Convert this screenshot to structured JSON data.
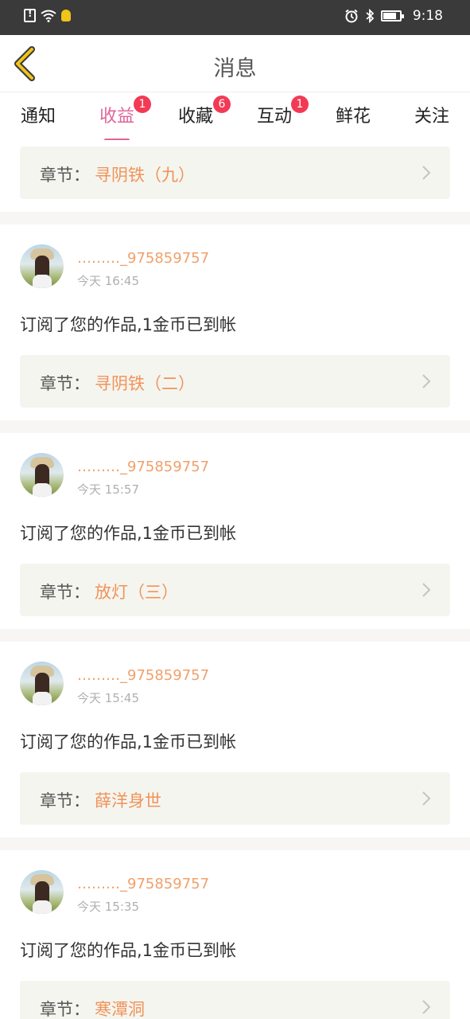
{
  "status_bar": {
    "time": "9:18"
  },
  "header": {
    "title": "消息"
  },
  "tabs": [
    {
      "label": "通知",
      "badge": "",
      "active": false
    },
    {
      "label": "收益",
      "badge": "1",
      "active": true
    },
    {
      "label": "收藏",
      "badge": "6",
      "active": false
    },
    {
      "label": "互动",
      "badge": "1",
      "active": false
    },
    {
      "label": "鲜花",
      "badge": "",
      "active": false
    },
    {
      "label": "关注",
      "badge": "",
      "active": false
    }
  ],
  "feed": {
    "chapter_label": "章节：",
    "top_item": {
      "chapter": "寻阴铁（九）"
    },
    "items": [
      {
        "user": "………_975859757",
        "time": "今天 16:45",
        "message": "订阅了您的作品,1金币已到帐",
        "chapter": "寻阴铁（二）"
      },
      {
        "user": "………_975859757",
        "time": "今天 15:57",
        "message": "订阅了您的作品,1金币已到帐",
        "chapter": "放灯（三）"
      },
      {
        "user": "………_975859757",
        "time": "今天 15:45",
        "message": "订阅了您的作品,1金币已到帐",
        "chapter": "薛洋身世"
      },
      {
        "user": "………_975859757",
        "time": "今天 15:35",
        "message": "订阅了您的作品,1金币已到帐",
        "chapter": "寒潭洞"
      }
    ]
  },
  "colors": {
    "accent": "#e0669a",
    "badge": "#f23a55",
    "username": "#f0a06a",
    "chapter": "#f0935a",
    "back_arrow": "#f0c419"
  }
}
